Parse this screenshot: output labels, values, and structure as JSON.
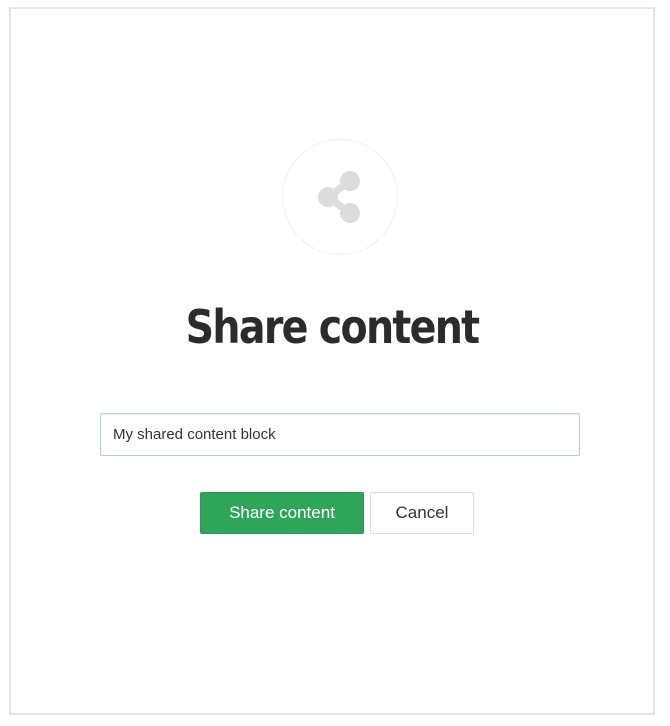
{
  "dialog": {
    "icon": "share-icon",
    "title": "Share content",
    "name_input": {
      "value": "My shared content block",
      "placeholder": ""
    },
    "buttons": {
      "share_label": "Share content",
      "cancel_label": "Cancel"
    }
  },
  "colors": {
    "primary": "#2ea55b",
    "icon": "#dcdcdc",
    "title": "#2b2b2b",
    "input_border": "#b7cbe0"
  }
}
